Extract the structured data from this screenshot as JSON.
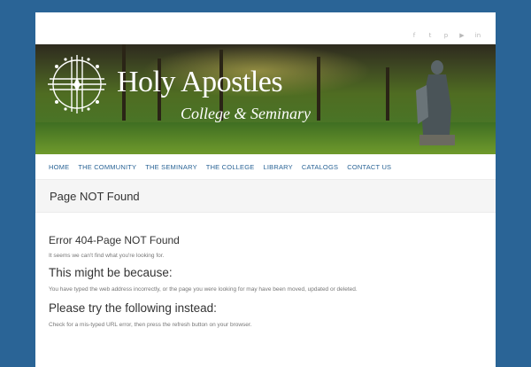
{
  "site": {
    "title": "Holy Apostles",
    "subtitle": "College & Seminary"
  },
  "social": {
    "icons": [
      "facebook-icon",
      "twitter-icon",
      "pinterest-icon",
      "youtube-icon",
      "linkedin-icon"
    ],
    "glyphs": [
      "f",
      "t",
      "p",
      "▶",
      "in"
    ]
  },
  "nav": {
    "items": [
      {
        "label": "HOME"
      },
      {
        "label": "THE COMMUNITY"
      },
      {
        "label": "THE SEMINARY"
      },
      {
        "label": "THE COLLEGE"
      },
      {
        "label": "LIBRARY"
      },
      {
        "label": "CATALOGS"
      },
      {
        "label": "CONTACT US"
      }
    ]
  },
  "page_title": "Page NOT Found",
  "content": {
    "error_heading": "Error 404-Page NOT Found",
    "intro": "It seems we can't find what you're looking for.",
    "reasons_heading": "This might be because:",
    "reasons_text": "You have typed the web address incorrectly, or the page you were looking for may have been moved, updated or deleted.",
    "instead_heading": "Please try the following instead:",
    "instead_text": "Check for a mis-typed URL error, then press the refresh button on your browser."
  },
  "colors": {
    "background": "#2a6496",
    "nav_link": "#2a6496",
    "title_bar": "#f5f5f5"
  }
}
